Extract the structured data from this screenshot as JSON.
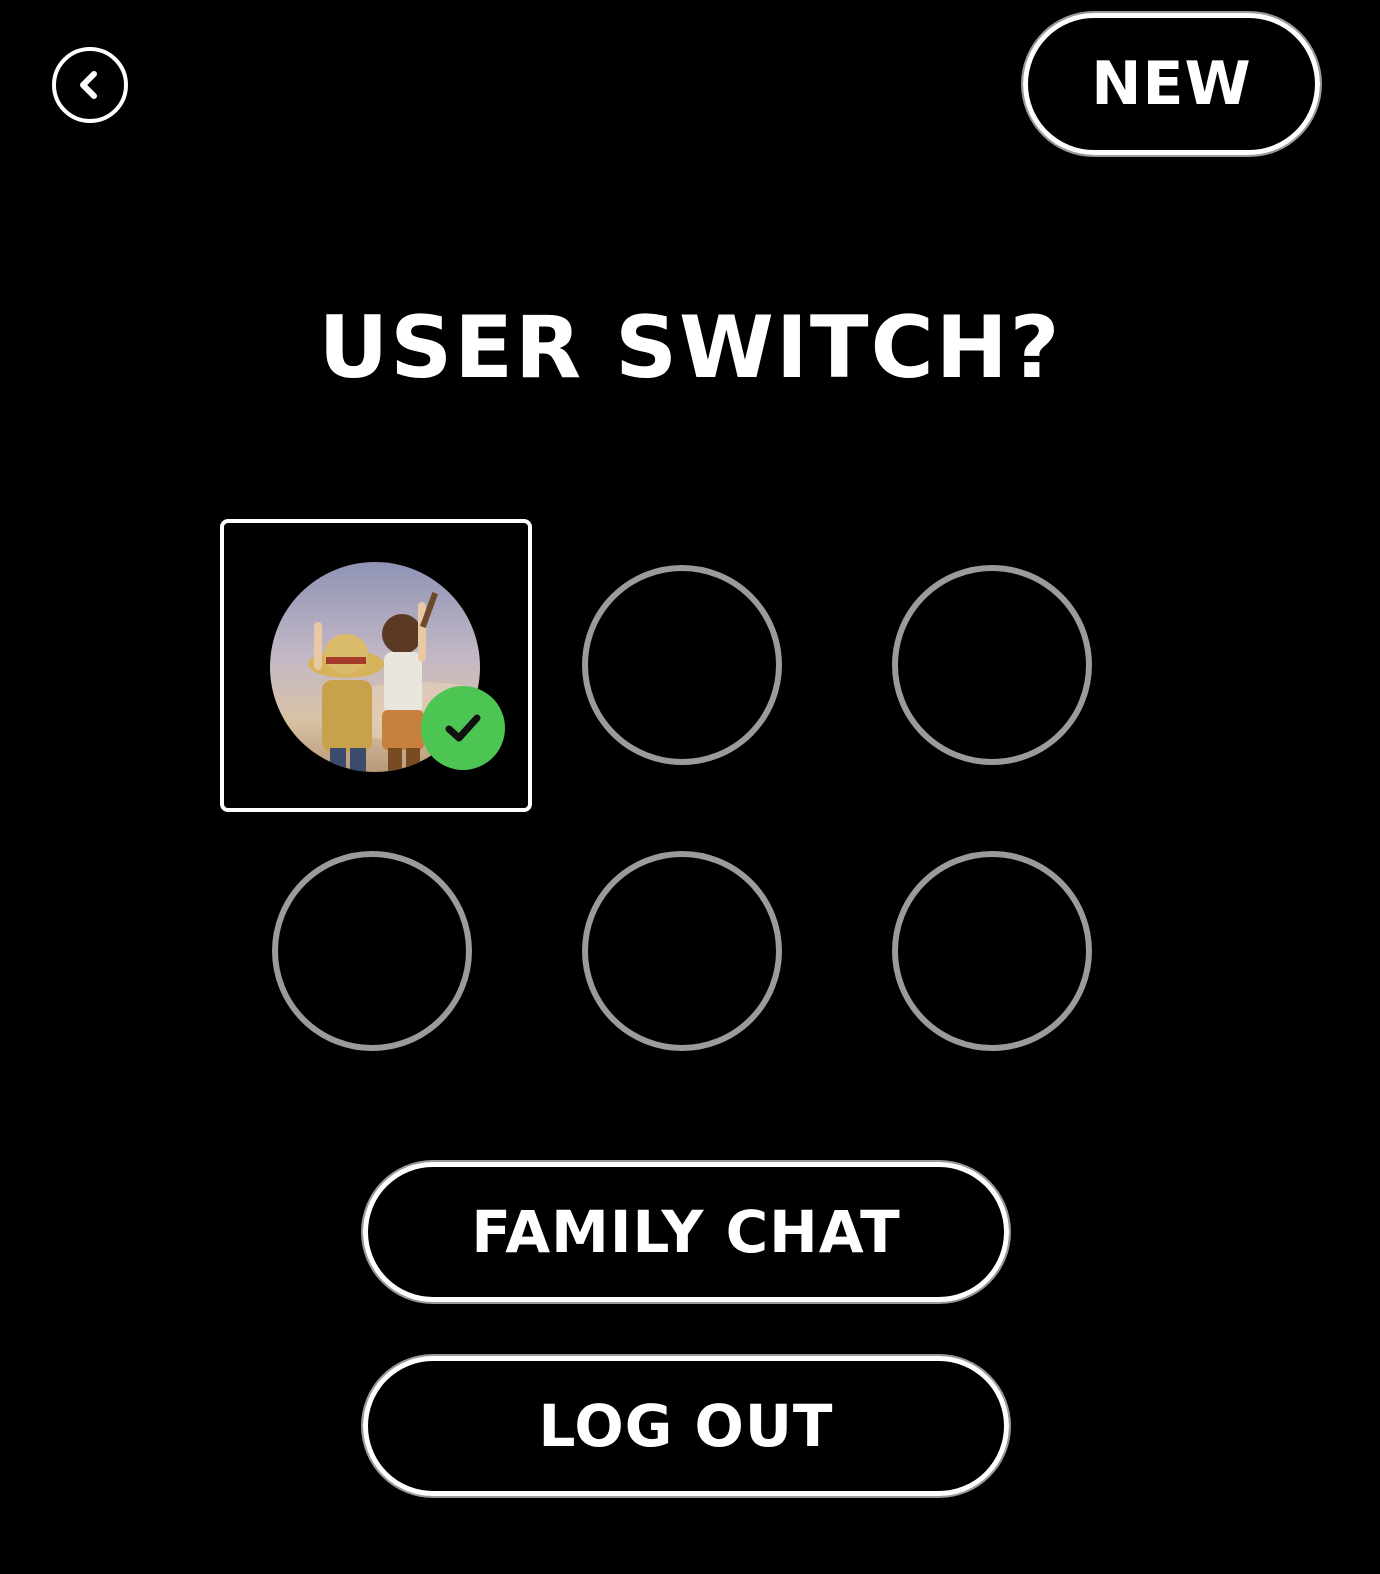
{
  "header": {
    "back_icon": "chevron-left-icon",
    "new_label": "NEW"
  },
  "title": "USER SWITCH?",
  "users": {
    "slots": [
      {
        "state": "selected",
        "has_avatar": true,
        "avatar_description_icon": "user-avatar-image"
      },
      {
        "state": "empty"
      },
      {
        "state": "empty"
      },
      {
        "state": "empty"
      },
      {
        "state": "empty"
      },
      {
        "state": "empty"
      }
    ],
    "check_icon": "checkmark-icon"
  },
  "actions": {
    "family_chat_label": "FAMILY CHAT",
    "logout_label": "LOG OUT"
  },
  "colors": {
    "background": "#000000",
    "foreground": "#ffffff",
    "empty_slot_ring": "#9b9b9b",
    "check_badge": "#4cc552"
  }
}
